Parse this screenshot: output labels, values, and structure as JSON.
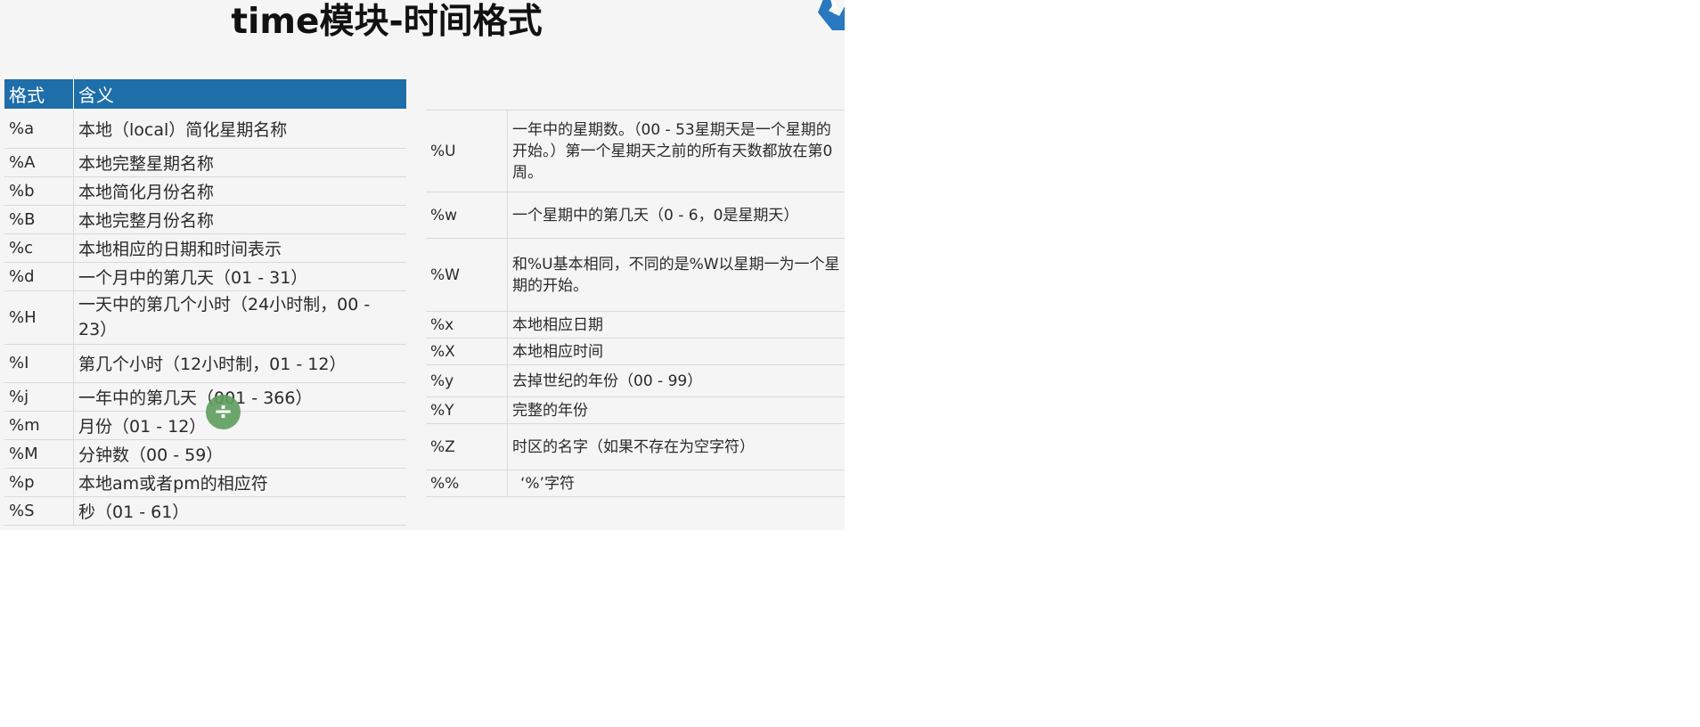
{
  "slide": {
    "title": "time模块-时间格式"
  },
  "left_table": {
    "headers": [
      "格式",
      "含义"
    ],
    "rows": [
      {
        "code": "%a",
        "meaning": "本地（local）简化星期名称"
      },
      {
        "code": "%A",
        "meaning": "本地完整星期名称"
      },
      {
        "code": "%b",
        "meaning": "本地简化月份名称"
      },
      {
        "code": "%B",
        "meaning": "本地完整月份名称"
      },
      {
        "code": "%c",
        "meaning": "本地相应的日期和时间表示"
      },
      {
        "code": "%d",
        "meaning": "一个月中的第几天（01 - 31）"
      },
      {
        "code": "%H",
        "meaning": "一天中的第几个小时（24小时制，00 - 23）"
      },
      {
        "code": "%I",
        "meaning": "第几个小时（12小时制，01 - 12）"
      },
      {
        "code": "%j",
        "meaning": "一年中的第几天（001 - 366）"
      },
      {
        "code": "%m",
        "meaning": "月份（01 - 12）"
      },
      {
        "code": "%M",
        "meaning": "分钟数（00 - 59）"
      },
      {
        "code": "%p",
        "meaning": "本地am或者pm的相应符"
      },
      {
        "code": "%S",
        "meaning": "秒（01 - 61）"
      }
    ]
  },
  "right_table": {
    "rows": [
      {
        "code": "%U",
        "meaning": "一年中的星期数。（00 - 53星期天是一个星期的开始。）第一个星期天之前的所有天数都放在第0周。"
      },
      {
        "code": "%w",
        "meaning": "一个星期中的第几天（0 - 6，0是星期天）"
      },
      {
        "code": "%W",
        "meaning": "和%U基本相同，不同的是%W以星期一为一个星期的开始。"
      },
      {
        "code": "%x",
        "meaning": "本地相应日期"
      },
      {
        "code": "%X",
        "meaning": "本地相应时间"
      },
      {
        "code": "%y",
        "meaning": "去掉世纪的年份（00 - 99）"
      },
      {
        "code": "%Y",
        "meaning": "完整的年份"
      },
      {
        "code": "%Z",
        "meaning": "时区的名字（如果不存在为空字符）"
      },
      {
        "code": "%%",
        "meaning": "‘%’字符"
      }
    ]
  },
  "overlay": {
    "cursor_icon": "divide-cursor-icon",
    "cursor_glyph": "÷",
    "cursor_color": "#5f9e5f"
  },
  "colors": {
    "header_bg": "#1e6ea9",
    "header_text": "#ffffff"
  }
}
